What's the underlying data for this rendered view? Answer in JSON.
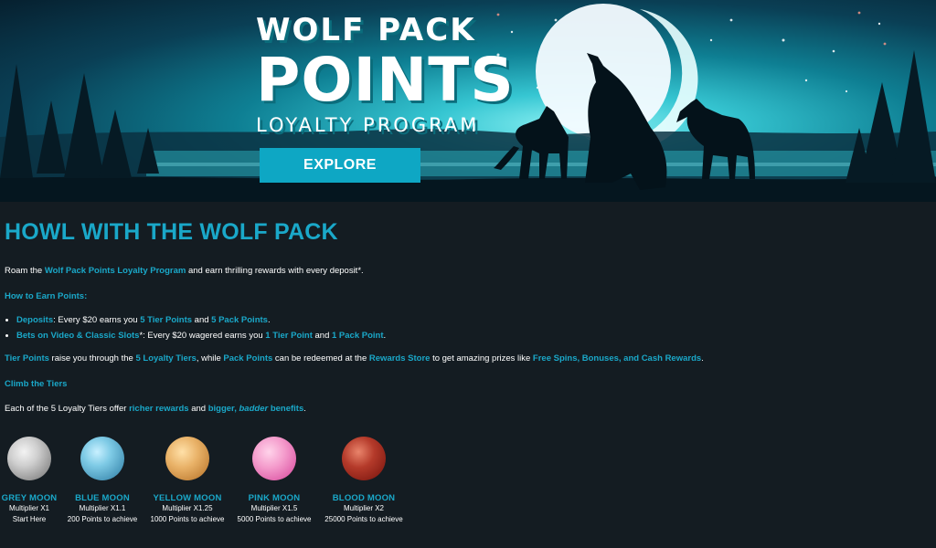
{
  "hero": {
    "title_line1": "WOLF PACK",
    "title_line2": "POINTS",
    "title_line3": "LOYALTY PROGRAM",
    "explore_label": "EXPLORE"
  },
  "content": {
    "heading": "HOWL WITH THE WOLF PACK",
    "intro": {
      "prefix": "Roam the ",
      "program_link": "Wolf Pack Points Loyalty Program",
      "suffix": " and earn thrilling rewards with every deposit*."
    },
    "how_to_earn": "How to Earn Points:",
    "earn_items": [
      {
        "lead": "Deposits",
        "text1": ": Every $20 earns you ",
        "tier": "5 Tier Points",
        "and": " and ",
        "pack": "5 Pack Points",
        "end": "."
      },
      {
        "lead": "Bets on Video & Classic Slots",
        "text1": "*: Every $20 wagered earns you ",
        "tier": "1 Tier Point",
        "and": " and ",
        "pack": "1 Pack Point",
        "end": "."
      }
    ],
    "tiers_paragraph": {
      "tier_points": "Tier Points",
      "t1": " raise you through the ",
      "loyalty_tiers": "5 Loyalty Tiers",
      "t2": ", while ",
      "pack_points": "Pack Points",
      "t3": " can be redeemed at the ",
      "rewards_store": "Rewards Store",
      "t4": " to get amazing prizes like ",
      "prizes": "Free Spins, Bonuses, and Cash Rewards",
      "t5": "."
    },
    "climb": "Climb the Tiers",
    "each": {
      "t1": "Each of the 5 Loyalty Tiers offer ",
      "richer": "richer rewards",
      "t2": " and ",
      "bigger": "bigger, ",
      "badder": "badder",
      "benefits": " benefits",
      "t3": "."
    }
  },
  "moons": [
    {
      "name": "GREY MOON",
      "multiplier": "Multiplier X1",
      "requirement": "Start Here",
      "color": "#b8b8b8"
    },
    {
      "name": "BLUE MOON",
      "multiplier": "Multiplier X1.1",
      "requirement": "200 Points to achieve",
      "color": "#6fbfe0"
    },
    {
      "name": "YELLOW MOON",
      "multiplier": "Multiplier X1.25",
      "requirement": "1000 Points to achieve",
      "color": "#e0a95e"
    },
    {
      "name": "PINK MOON",
      "multiplier": "Multiplier X1.5",
      "requirement": "5000 Points to achieve",
      "color": "#f08ac4"
    },
    {
      "name": "BLOOD MOON",
      "multiplier": "Multiplier X2",
      "requirement": "25000 Points to achieve",
      "color": "#a12d20"
    }
  ],
  "colors": {
    "accent": "#1aa8c9",
    "button": "#0ea7c4",
    "background": "#141c22"
  }
}
